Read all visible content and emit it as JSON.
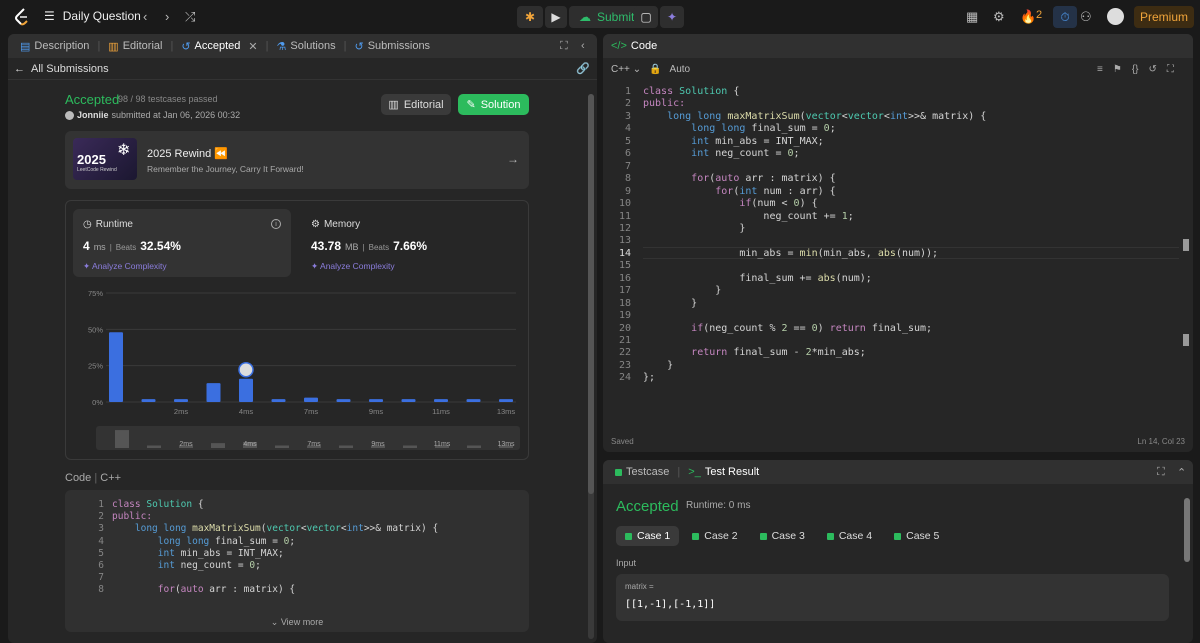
{
  "topbar": {
    "title": "Daily Question",
    "submit_label": "Submit",
    "streak_count": "2",
    "premium_label": "Premium"
  },
  "left": {
    "tabs": [
      {
        "label": "Description"
      },
      {
        "label": "Editorial"
      },
      {
        "label": "Accepted"
      },
      {
        "label": "Solutions"
      },
      {
        "label": "Submissions"
      }
    ],
    "back_label": "All Submissions",
    "status": "Accepted",
    "testcases": "98 / 98 testcases passed",
    "author_name": "Jonniie",
    "submitted_text": "submitted at Jan 06, 2026 00:32",
    "editorial_btn": "Editorial",
    "solution_btn": "Solution",
    "rewind": {
      "img_year": "2025",
      "img_sub": "LeetCode Rewind",
      "title": "2025 Rewind ⏪",
      "subtitle": "Remember the Journey, Carry It Forward!"
    },
    "runtime": {
      "title": "Runtime",
      "value": "4",
      "unit": "ms",
      "beats_label": "Beats",
      "beats": "32.54%",
      "analyze": "Analyze Complexity"
    },
    "memory": {
      "title": "Memory",
      "value": "43.78",
      "unit": "MB",
      "beats_label": "Beats",
      "beats": "7.66%",
      "analyze": "Analyze Complexity"
    },
    "code_label": "Code",
    "code_lang": "C++",
    "view_more": "View more"
  },
  "chart_data": {
    "type": "bar",
    "yticks": [
      "75%",
      "50%",
      "25%",
      "0%"
    ],
    "ylim": [
      0,
      75
    ],
    "xticks": [
      "2ms",
      "4ms",
      "7ms",
      "9ms",
      "11ms",
      "13ms"
    ],
    "values": [
      48,
      2,
      2,
      13,
      16,
      2,
      3,
      2,
      2,
      2,
      2,
      2,
      2
    ],
    "highlight_index": 4
  },
  "code": {
    "lang": "C++",
    "mode": "Auto",
    "saved": "Saved",
    "cursor": "Ln 14, Col 23",
    "active_line": 14,
    "lines": [
      "class Solution {",
      "public:",
      "    long long maxMatrixSum(vector<vector<int>>& matrix) {",
      "        long long final_sum = 0;",
      "        int min_abs = INT_MAX;",
      "        int neg_count = 0;",
      "",
      "        for(auto arr : matrix) {",
      "            for(int num : arr) {",
      "                if(num < 0) {",
      "                    neg_count += 1;",
      "                }",
      "",
      "                min_abs = min(min_abs, abs(num));",
      "",
      "                final_sum += abs(num);",
      "            }",
      "        }",
      "",
      "        if(neg_count % 2 == 0) return final_sum;",
      "",
      "        return final_sum - 2*min_abs;",
      "    }",
      "};"
    ]
  },
  "test": {
    "tab_testcase": "Testcase",
    "tab_result": "Test Result",
    "status": "Accepted",
    "runtime": "Runtime: 0 ms",
    "cases": [
      "Case 1",
      "Case 2",
      "Case 3",
      "Case 4",
      "Case 5"
    ],
    "input_label": "Input",
    "input_name": "matrix =",
    "input_value": "[[1,-1],[-1,1]]"
  },
  "code_panel_title": "Code"
}
